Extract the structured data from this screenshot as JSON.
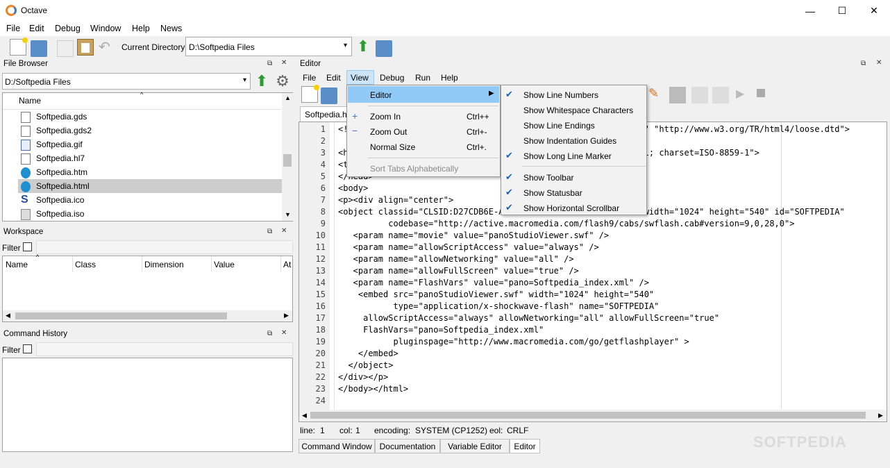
{
  "window": {
    "title": "Octave",
    "minimize": "—",
    "maximize": "☐",
    "close": "✕"
  },
  "menubar": [
    "File",
    "Edit",
    "Debug",
    "Window",
    "Help",
    "News"
  ],
  "toolbar": {
    "current_dir_label": "Current Directory:",
    "current_dir_value": "D:\\Softpedia Files"
  },
  "file_browser": {
    "title": "File Browser",
    "path": "D:/Softpedia Files",
    "column": "Name",
    "files": [
      {
        "name": "Softpedia.gds",
        "icon": "file-icon"
      },
      {
        "name": "Softpedia.gds2",
        "icon": "file-icon"
      },
      {
        "name": "Softpedia.gif",
        "icon": "image-file-icon"
      },
      {
        "name": "Softpedia.hl7",
        "icon": "file-icon"
      },
      {
        "name": "Softpedia.htm",
        "icon": "edge-icon"
      },
      {
        "name": "Softpedia.html",
        "icon": "edge-icon",
        "selected": true
      },
      {
        "name": "Softpedia.ico",
        "icon": "softpedia-icon"
      },
      {
        "name": "Softpedia.iso",
        "icon": "disc-icon"
      }
    ]
  },
  "workspace": {
    "title": "Workspace",
    "filter_label": "Filter",
    "columns": [
      "Name",
      "Class",
      "Dimension",
      "Value",
      "At"
    ]
  },
  "command_history": {
    "title": "Command History",
    "filter_label": "Filter"
  },
  "editor": {
    "title": "Editor",
    "menu": [
      "File",
      "Edit",
      "View",
      "Debug",
      "Run",
      "Help"
    ],
    "tab": "Softpedia.ht",
    "lines": [
      "<!DOCTYPE HTML PUBLIC \"-//W3C//DTD HTML 4.01 Transitional//EN\" \"http://www.w3.org/TR/html4/loose.dtd\">",
      "",
      "<html><head><meta http-equiv=\"Content-Type\" content=\"text/html; charset=ISO-8859-1\">",
      "<title>Softpedia</title>",
      "</head>",
      "<body>",
      "<p><div align=\"center\">",
      "<object classid=\"CLSID:D27CDB6E-AE6D-11cf-96B8-444553540000\" width=\"1024\" height=\"540\" id=\"SOFTPEDIA\"",
      "          codebase=\"http://active.macromedia.com/flash9/cabs/swflash.cab#version=9,0,28,0\">",
      "   <param name=\"movie\" value=\"panoStudioViewer.swf\" />",
      "   <param name=\"allowScriptAccess\" value=\"always\" />",
      "   <param name=\"allowNetworking\" value=\"all\" />",
      "   <param name=\"allowFullScreen\" value=\"true\" />",
      "   <param name=\"FlashVars\" value=\"pano=Softpedia_index.xml\" />",
      "    <embed src=\"panoStudioViewer.swf\" width=\"1024\" height=\"540\"",
      "           type=\"application/x-shockwave-flash\" name=\"SOFTPEDIA\"",
      "     allowScriptAccess=\"always\" allowNetworking=\"all\" allowFullScreen=\"true\"",
      "     FlashVars=\"pano=Softpedia_index.xml\"",
      "           pluginspage=\"http://www.macromedia.com/go/getflashplayer\" >",
      "    </embed>",
      "  </object>",
      "</div></p>",
      "</body></html>",
      ""
    ],
    "status": {
      "line_label": "line:",
      "line": "1",
      "col_label": "col:",
      "col": "1",
      "enc_label": "encoding:",
      "enc": "SYSTEM (CP1252)",
      "eol_label": "eol:",
      "eol": "CRLF"
    }
  },
  "view_menu": {
    "editor": "Editor",
    "zoom_in": "Zoom In",
    "zoom_in_sc": "Ctrl++",
    "zoom_out": "Zoom Out",
    "zoom_out_sc": "Ctrl+-",
    "normal_size": "Normal Size",
    "normal_size_sc": "Ctrl+.",
    "sort_tabs": "Sort Tabs Alphabetically"
  },
  "editor_submenu": [
    {
      "label": "Show Line Numbers",
      "checked": true
    },
    {
      "label": "Show Whitespace Characters",
      "checked": false
    },
    {
      "label": "Show Line Endings",
      "checked": false
    },
    {
      "label": "Show Indentation Guides",
      "checked": false
    },
    {
      "label": "Show Long Line Marker",
      "checked": true
    },
    {
      "label": "Show Toolbar",
      "checked": true
    },
    {
      "label": "Show Statusbar",
      "checked": true
    },
    {
      "label": "Show Horizontal Scrollbar",
      "checked": true
    }
  ],
  "bottom_tabs": [
    "Command Window",
    "Documentation",
    "Variable Editor",
    "Editor"
  ],
  "watermark": "SOFTPEDIA"
}
